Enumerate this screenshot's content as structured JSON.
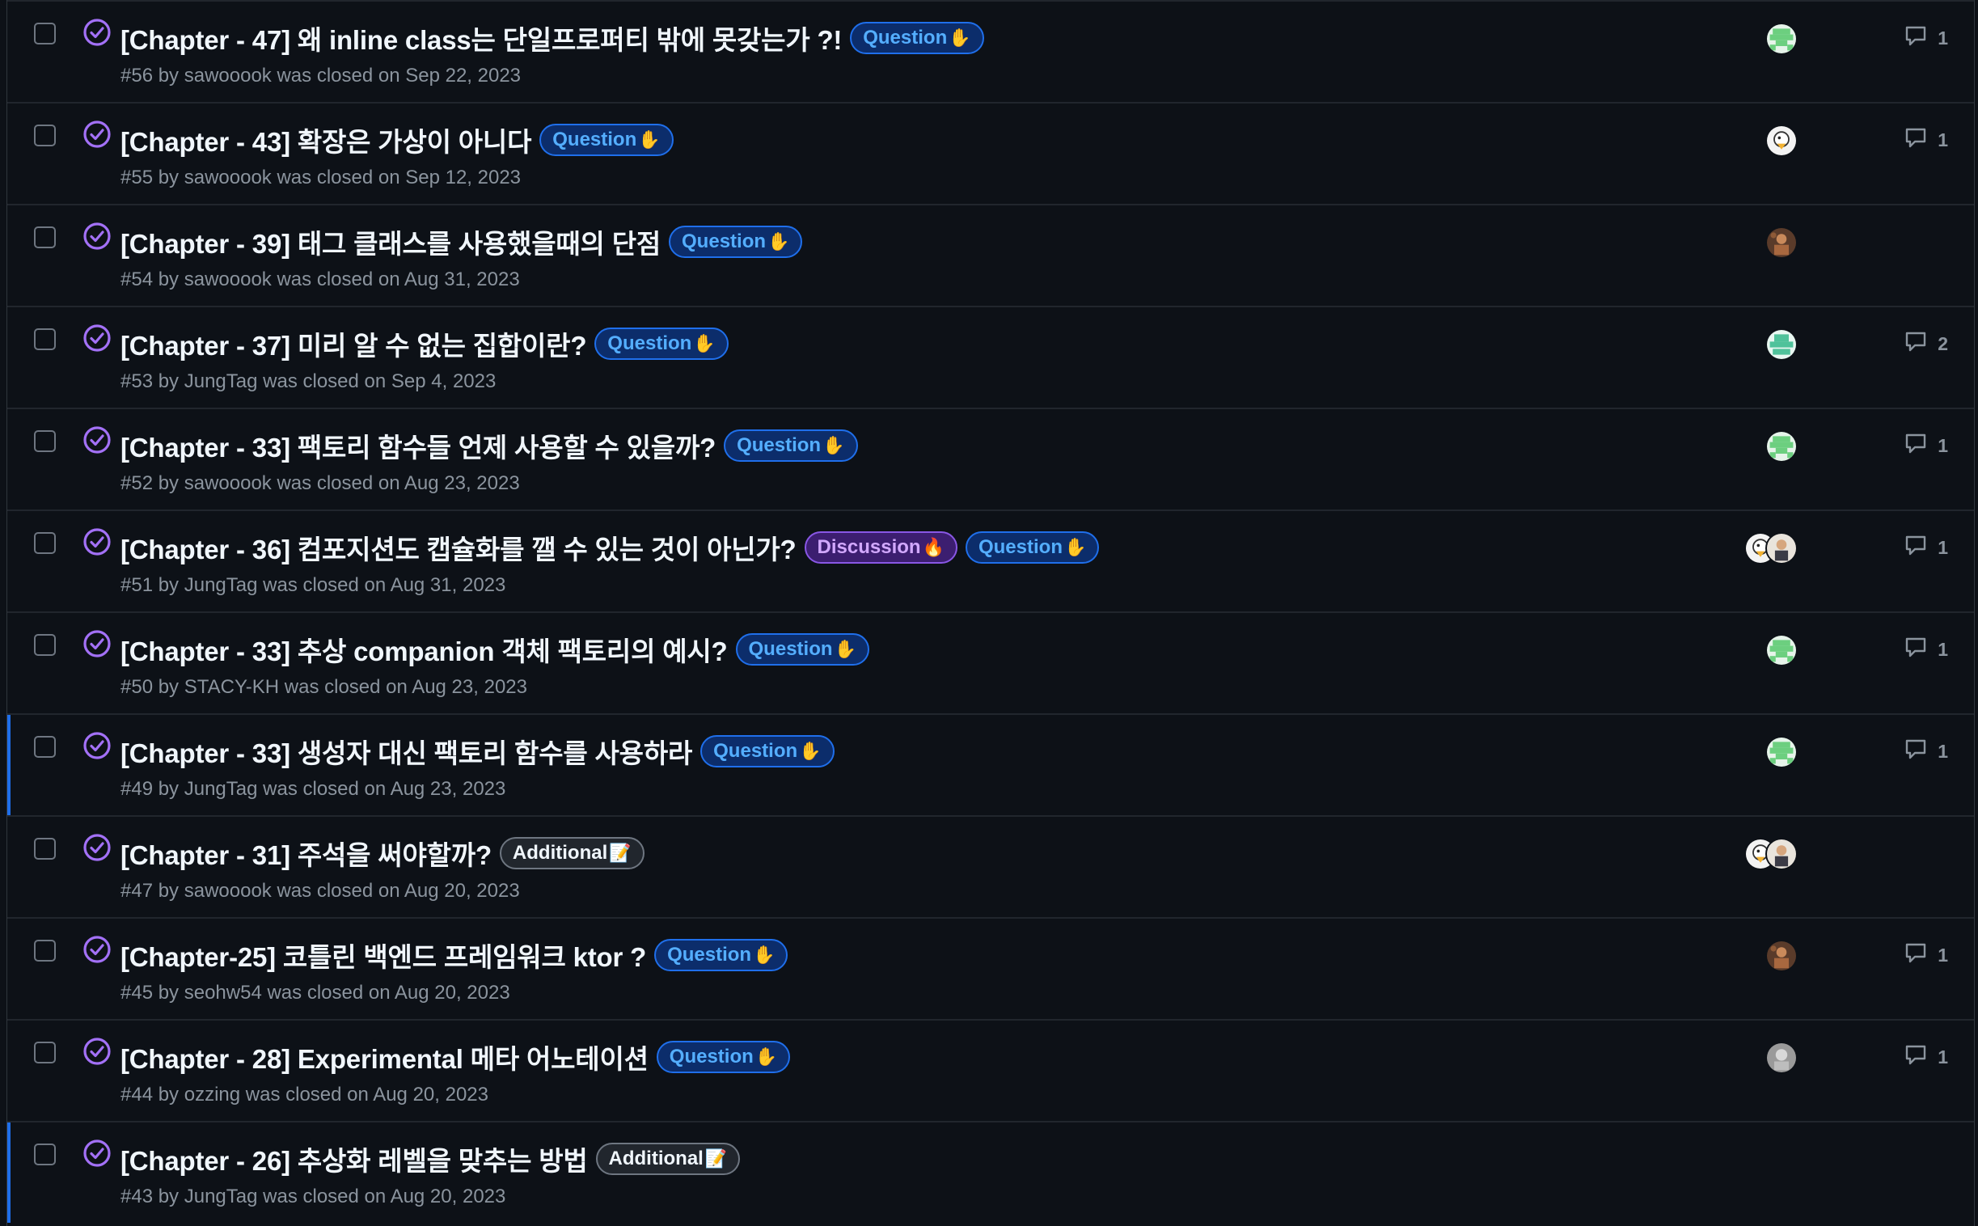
{
  "colors": {
    "closed_icon": "#a371f7",
    "question_label_text": "#54aeff",
    "question_label_border": "#1f6feb",
    "question_label_bg": "#0c2d6b",
    "discussion_label_text": "#d2a8ff",
    "discussion_label_border": "#8957e5",
    "discussion_label_bg": "#3c1e70",
    "additional_label_text": "#f0f6fc",
    "additional_label_border": "#6e7681",
    "additional_label_bg": "#21262d",
    "selection_bar": "#1f6feb"
  },
  "labels": {
    "question": {
      "text": "Question",
      "emoji": "✋"
    },
    "discussion": {
      "text": "Discussion",
      "emoji": "🔥"
    },
    "additional": {
      "text": "Additional",
      "emoji": "📝"
    }
  },
  "issues": [
    {
      "title": "[Chapter - 47] 왜 inline class는 단일프로퍼티 밖에 못갖는가 ?!",
      "labels": [
        "question"
      ],
      "meta": "#56 by sawooook was closed on Sep 22, 2023",
      "avatars": [
        "identicon-green"
      ],
      "comments": "1",
      "selected": false
    },
    {
      "title": "[Chapter - 43] 확장은 가상이 아니다",
      "labels": [
        "question"
      ],
      "meta": "#55 by sawooook was closed on Sep 12, 2023",
      "avatars": [
        "duck-avatar"
      ],
      "comments": "1",
      "selected": false
    },
    {
      "title": "[Chapter - 39] 태그 클래스를 사용했을때의 단점",
      "labels": [
        "question"
      ],
      "meta": "#54 by sawooook was closed on Aug 31, 2023",
      "avatars": [
        "photo-avatar"
      ],
      "comments": "",
      "selected": false
    },
    {
      "title": "[Chapter - 37] 미리 알 수 없는 집합이란?",
      "labels": [
        "question"
      ],
      "meta": "#53 by JungTag was closed on Sep 4, 2023",
      "avatars": [
        "identicon-teal"
      ],
      "comments": "2",
      "selected": false
    },
    {
      "title": "[Chapter - 33] 팩토리 함수들 언제 사용할 수 있을까?",
      "labels": [
        "question"
      ],
      "meta": "#52 by sawooook was closed on Aug 23, 2023",
      "avatars": [
        "identicon-green"
      ],
      "comments": "1",
      "selected": false
    },
    {
      "title": "[Chapter - 36] 컴포지션도 캡슐화를 깰 수 있는 것이 아닌가?",
      "labels": [
        "discussion",
        "question"
      ],
      "meta": "#51 by JungTag was closed on Aug 31, 2023",
      "avatars": [
        "duck-avatar",
        "person-avatar"
      ],
      "comments": "1",
      "selected": false
    },
    {
      "title": "[Chapter - 33] 추상 companion 객체 팩토리의 예시?",
      "labels": [
        "question"
      ],
      "meta": "#50 by STACY-KH was closed on Aug 23, 2023",
      "avatars": [
        "identicon-green"
      ],
      "comments": "1",
      "selected": false
    },
    {
      "title": "[Chapter - 33] 생성자 대신 팩토리 함수를 사용하라",
      "labels": [
        "question"
      ],
      "meta": "#49 by JungTag was closed on Aug 23, 2023",
      "avatars": [
        "identicon-green"
      ],
      "comments": "1",
      "selected": true
    },
    {
      "title": "[Chapter - 31] 주석을 써야할까?",
      "labels": [
        "additional"
      ],
      "meta": "#47 by sawooook was closed on Aug 20, 2023",
      "avatars": [
        "duck-avatar",
        "person-avatar"
      ],
      "comments": "",
      "selected": false
    },
    {
      "title": "[Chapter-25] 코틀린 백엔드 프레임워크 ktor ?",
      "labels": [
        "question"
      ],
      "meta": "#45 by seohw54 was closed on Aug 20, 2023",
      "avatars": [
        "photo-avatar"
      ],
      "comments": "1",
      "selected": false
    },
    {
      "title": "[Chapter - 28] Experimental 메타 어노테이션",
      "labels": [
        "question"
      ],
      "meta": "#44 by ozzing was closed on Aug 20, 2023",
      "avatars": [
        "grey-avatar"
      ],
      "comments": "1",
      "selected": false
    },
    {
      "title": "[Chapter - 26] 추상화 레벨을 맞추는 방법",
      "labels": [
        "additional"
      ],
      "meta": "#43 by JungTag was closed on Aug 20, 2023",
      "avatars": [],
      "comments": "",
      "selected": true
    }
  ]
}
